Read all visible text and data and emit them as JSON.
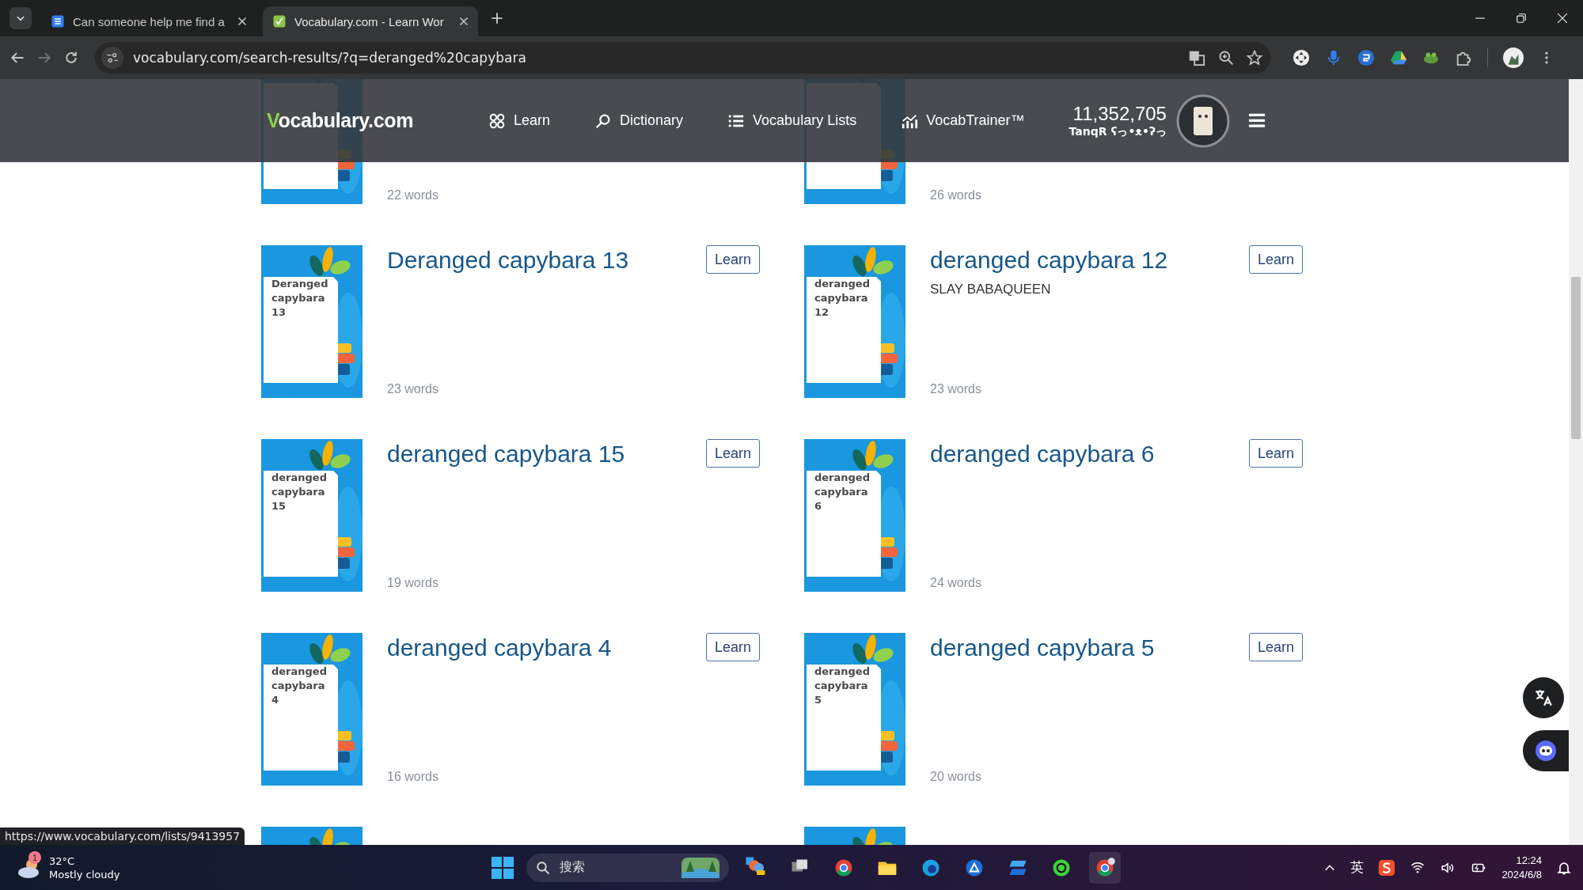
{
  "browser": {
    "tabs": [
      {
        "title": "Can someone help me find a",
        "selected": false
      },
      {
        "title": "Vocabulary.com - Learn Wor",
        "selected": true
      }
    ],
    "url": "vocabulary.com/search-results/?q=deranged%20capybara"
  },
  "header": {
    "logo": "Vocabulary.com",
    "nav": [
      {
        "label": "Learn"
      },
      {
        "label": "Dictionary"
      },
      {
        "label": "Vocabulary Lists"
      },
      {
        "label": "VocabTrainer™"
      }
    ],
    "points": "11,352,705",
    "username": "TanqR ʕっ•ᴥ•ʔっ"
  },
  "lists": [
    {
      "kind": "list",
      "words": "22 words"
    },
    {
      "kind": "list",
      "words": "26 words"
    },
    {
      "cover_text": "Deranged capybara 13",
      "title": "Deranged capybara 13",
      "words": "23 words",
      "button": "Learn"
    },
    {
      "cover_text": "deranged capybara 12",
      "title": "deranged capybara 12",
      "description": "SLAY BABAQUEEN",
      "words": "23 words",
      "button": "Learn"
    },
    {
      "cover_text": "deranged capybara 15",
      "title": "deranged capybara 15",
      "words": "19 words",
      "button": "Learn"
    },
    {
      "cover_text": "deranged capybara 6",
      "title": "deranged capybara 6",
      "words": "24 words",
      "button": "Learn"
    },
    {
      "cover_text": "deranged capybara 4",
      "title": "deranged capybara 4",
      "words": "16 words",
      "button": "Learn"
    },
    {
      "cover_text": "deranged capybara 5",
      "title": "deranged capybara 5",
      "words": "20 words",
      "button": "Learn"
    },
    {
      "kind": "cover_only"
    },
    {
      "kind": "cover_only"
    }
  ],
  "status_link": "https://www.vocabulary.com/lists/9413957",
  "taskbar": {
    "weather_badge": "1",
    "temperature": "32°C",
    "condition": "Mostly cloudy",
    "search_placeholder": "搜索",
    "ime": "英",
    "time": "12:24",
    "date": "2024/6/8"
  }
}
